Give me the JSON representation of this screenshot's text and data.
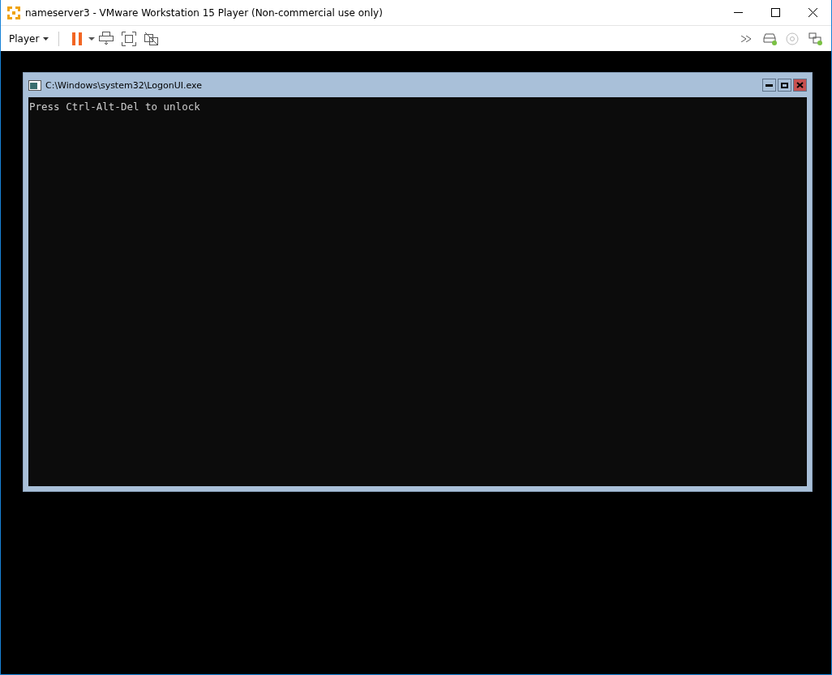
{
  "window": {
    "title": "nameserver3 - VMware Workstation 15 Player (Non-commercial use only)"
  },
  "toolbar": {
    "menu": "Player"
  },
  "devices": [
    {
      "kind": "disk",
      "connected": true
    },
    {
      "kind": "cd",
      "connected": false
    },
    {
      "kind": "network",
      "connected": true
    }
  ],
  "console": {
    "title": "C:\\Windows\\system32\\LogonUI.exe",
    "text": "Press Ctrl-Alt-Del to unlock"
  }
}
